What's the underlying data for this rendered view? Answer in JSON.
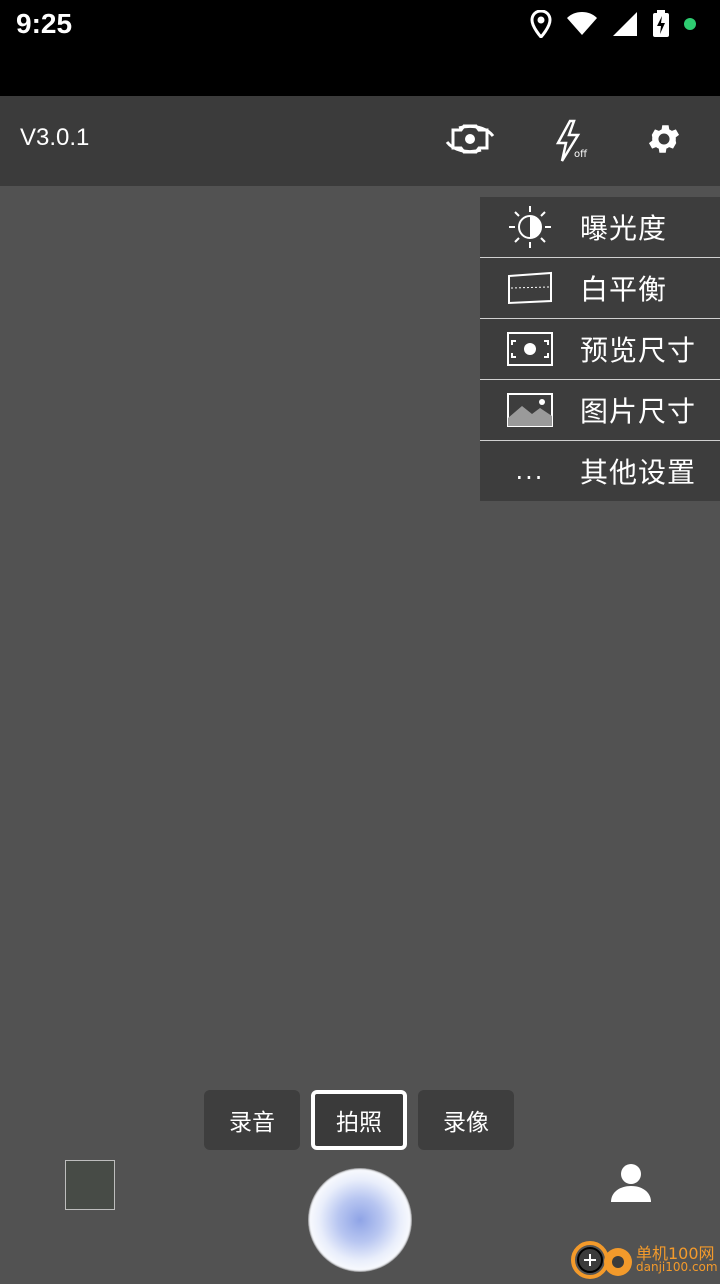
{
  "status_bar": {
    "time": "9:25",
    "icons": [
      "location-icon",
      "wifi-icon",
      "signal-icon",
      "battery-charging-icon",
      "notification-dot-icon"
    ],
    "dot_color": "#2ecc71"
  },
  "toolbar": {
    "version": "V3.0.1",
    "icons": [
      "switch-camera-icon",
      "flash-off-icon",
      "gear-icon"
    ],
    "flash_badge": "off"
  },
  "menu": {
    "items": [
      {
        "label": "曝光度",
        "icon": "brightness-icon"
      },
      {
        "label": "白平衡",
        "icon": "white-balance-icon"
      },
      {
        "label": "预览尺寸",
        "icon": "preview-size-icon"
      },
      {
        "label": "图片尺寸",
        "icon": "image-size-icon"
      },
      {
        "label": "其他设置",
        "icon": "more-icon",
        "icon_text": "..."
      }
    ]
  },
  "modes": {
    "items": [
      "录音",
      "拍照",
      "录像"
    ],
    "active": "拍照"
  },
  "watermark": {
    "text": "单机100网",
    "sub": "danji100.com"
  },
  "colors": {
    "background": "#525252",
    "toolbar": "#3b3b3b",
    "menu": "#3d3d3d",
    "watermark": "#f39a2b"
  }
}
